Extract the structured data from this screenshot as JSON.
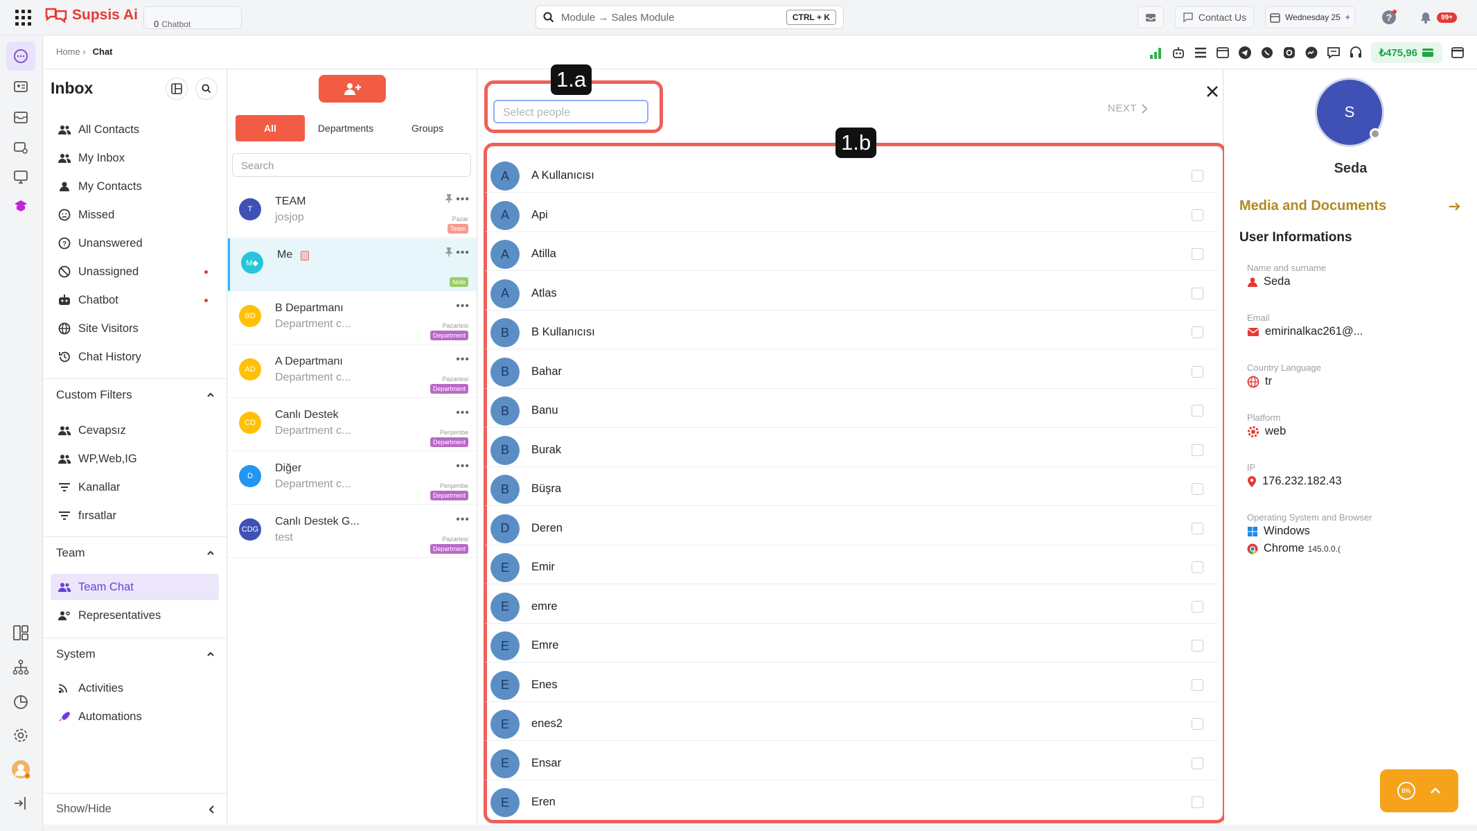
{
  "topbar": {
    "brand": "Supsis Ai",
    "chatbot_label": "Chatbot",
    "chatbot_count": "0",
    "module_search": "Module → Sales Module",
    "shortcut": "CTRL + K",
    "contact_us": "Contact Us",
    "date": "Wednesday 25",
    "notif_count": "99+"
  },
  "breadcrumb": {
    "home": "Home ›",
    "current": "Chat"
  },
  "balance": "₺475,96",
  "sidebar": {
    "title": "Inbox",
    "items": [
      {
        "label": "All Contacts",
        "icon": "users-icon"
      },
      {
        "label": "My Inbox",
        "icon": "users-icon"
      },
      {
        "label": "My Contacts",
        "icon": "user-icon"
      },
      {
        "label": "Missed",
        "icon": "sad-face-icon"
      },
      {
        "label": "Unanswered",
        "icon": "question-circle-icon"
      },
      {
        "label": "Unassigned",
        "icon": "block-icon"
      },
      {
        "label": "Chatbot",
        "icon": "robot-icon"
      },
      {
        "label": "Site Visitors",
        "icon": "globe-icon"
      },
      {
        "label": "Chat History",
        "icon": "history-icon"
      }
    ],
    "custom_filters": "Custom Filters",
    "filters": [
      "Cevapsız",
      "WP,Web,IG",
      "Kanallar",
      "fırsatlar"
    ],
    "team": "Team",
    "team_items": [
      "Team Chat",
      "Representatives"
    ],
    "system": "System",
    "system_items": [
      "Activities",
      "Automations"
    ],
    "show_hide": "Show/Hide"
  },
  "chatlist": {
    "tabs": [
      "All",
      "Departments",
      "Groups"
    ],
    "search_placeholder": "Search",
    "conversations": [
      {
        "initials": "T",
        "name": "TEAM",
        "sub": "josjop",
        "day": "Pazar",
        "tag": "Team",
        "color": "#3f51b5",
        "tag_color": "#f79b8f",
        "pinned": true
      },
      {
        "initials": "M◆",
        "name": "Me",
        "sub": "",
        "day": "",
        "tag": "Note",
        "color": "#26c6da",
        "tag_color": "#9ccc65",
        "pinned": true
      },
      {
        "initials": "BD",
        "name": "B Departmanı",
        "sub": "Department c...",
        "day": "Pazartesi",
        "tag": "Department",
        "color": "#ffc107",
        "tag_color": "#ba68c8",
        "pinned": false
      },
      {
        "initials": "AD",
        "name": "A Departmanı",
        "sub": "Department c...",
        "day": "Pazartesi",
        "tag": "Department",
        "color": "#ffc107",
        "tag_color": "#ba68c8",
        "pinned": false
      },
      {
        "initials": "CD",
        "name": "Canlı Destek",
        "sub": "Department c...",
        "day": "Perşembe",
        "tag": "Department",
        "color": "#ffc107",
        "tag_color": "#ba68c8",
        "pinned": false
      },
      {
        "initials": "D",
        "name": "Diğer",
        "sub": "Department c...",
        "day": "Perşembe",
        "tag": "Department",
        "color": "#2196f3",
        "tag_color": "#ba68c8",
        "pinned": false
      },
      {
        "initials": "CDG",
        "name": "Canlı Destek G...",
        "sub": "test",
        "day": "Pazartesi",
        "tag": "Department",
        "color": "#3f51b5",
        "tag_color": "#ba68c8",
        "pinned": false
      }
    ]
  },
  "panel": {
    "select_placeholder": "Select people",
    "next": "NEXT",
    "label_a": "1.a",
    "label_b": "1.b",
    "people": [
      {
        "initial": "A",
        "name": "A Kullanıcısı"
      },
      {
        "initial": "A",
        "name": "Api"
      },
      {
        "initial": "A",
        "name": "Atilla"
      },
      {
        "initial": "A",
        "name": "Atlas"
      },
      {
        "initial": "B",
        "name": "B Kullanıcısı"
      },
      {
        "initial": "B",
        "name": "Bahar"
      },
      {
        "initial": "B",
        "name": "Banu"
      },
      {
        "initial": "B",
        "name": "Burak"
      },
      {
        "initial": "B",
        "name": "Büşra"
      },
      {
        "initial": "D",
        "name": "Deren"
      },
      {
        "initial": "E",
        "name": "Emir"
      },
      {
        "initial": "E",
        "name": "emre"
      },
      {
        "initial": "E",
        "name": "Emre"
      },
      {
        "initial": "E",
        "name": "Enes"
      },
      {
        "initial": "E",
        "name": "enes2"
      },
      {
        "initial": "E",
        "name": "Ensar"
      },
      {
        "initial": "E",
        "name": "Eren"
      }
    ]
  },
  "info": {
    "avatar_initial": "S",
    "name": "Seda",
    "media_title": "Media and Documents",
    "user_info_title": "User Informations",
    "fields": [
      {
        "key": "Name and surname",
        "value": "Seda"
      },
      {
        "key": "Email",
        "value": "emirinalkac261@..."
      },
      {
        "key": "Country Language",
        "value": "tr"
      },
      {
        "key": "Platform",
        "value": "web"
      },
      {
        "key": "IP",
        "value": "176.232.182.43"
      },
      {
        "key": "Operating System and Browser",
        "value": "Windows"
      }
    ],
    "browser": "Chrome",
    "browser_version": "145.0.0.("
  },
  "fab_percent": "0%"
}
